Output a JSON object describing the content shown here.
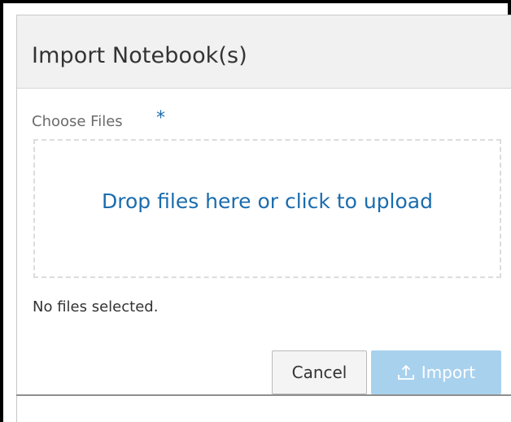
{
  "dialog": {
    "title": "Import Notebook(s)",
    "field_label": "Choose Files",
    "required_marker": "*",
    "dropzone_text": "Drop files here or click to upload",
    "file_status": "No files selected.",
    "buttons": {
      "cancel_label": "Cancel",
      "import_label": "Import",
      "import_icon": "upload-icon"
    }
  },
  "colors": {
    "accent": "#1b6cad",
    "import_button_disabled": "#a8d1ee",
    "header_bg": "#f1f1f1"
  }
}
